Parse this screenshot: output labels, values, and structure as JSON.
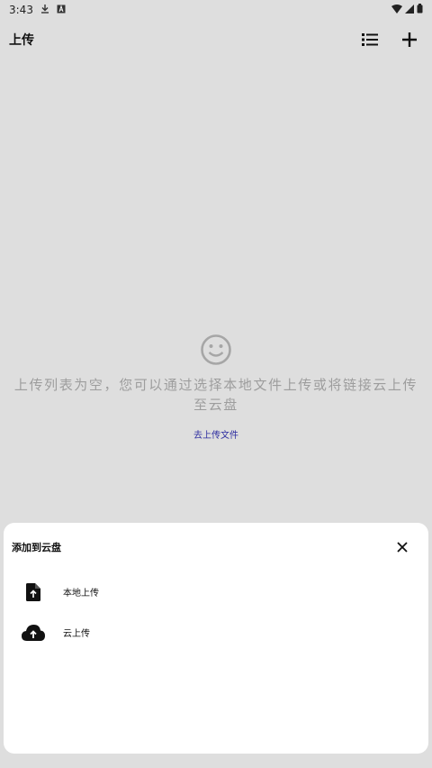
{
  "status_bar": {
    "time": "3:43",
    "icons": [
      "download-icon",
      "a-icon",
      "wifi-icon",
      "signal-icon",
      "battery-icon"
    ]
  },
  "app_bar": {
    "title": "上传",
    "actions": [
      "list-icon",
      "add-icon"
    ]
  },
  "empty_state": {
    "icon": "smiley-icon",
    "message": "上传列表为空，您可以通过选择本地文件上传或将链接云上传至云盘",
    "link_label": "去上传文件"
  },
  "bottom_sheet": {
    "title": "添加到云盘",
    "close_icon": "close-icon",
    "items": [
      {
        "label": "本地上传",
        "icon": "file-upload-icon"
      },
      {
        "label": "云上传",
        "icon": "cloud-upload-icon"
      }
    ]
  },
  "colors": {
    "background": "#dedede",
    "sheet": "#ffffff",
    "link": "#2c2ca0",
    "muted_text": "#9d9d9d"
  }
}
